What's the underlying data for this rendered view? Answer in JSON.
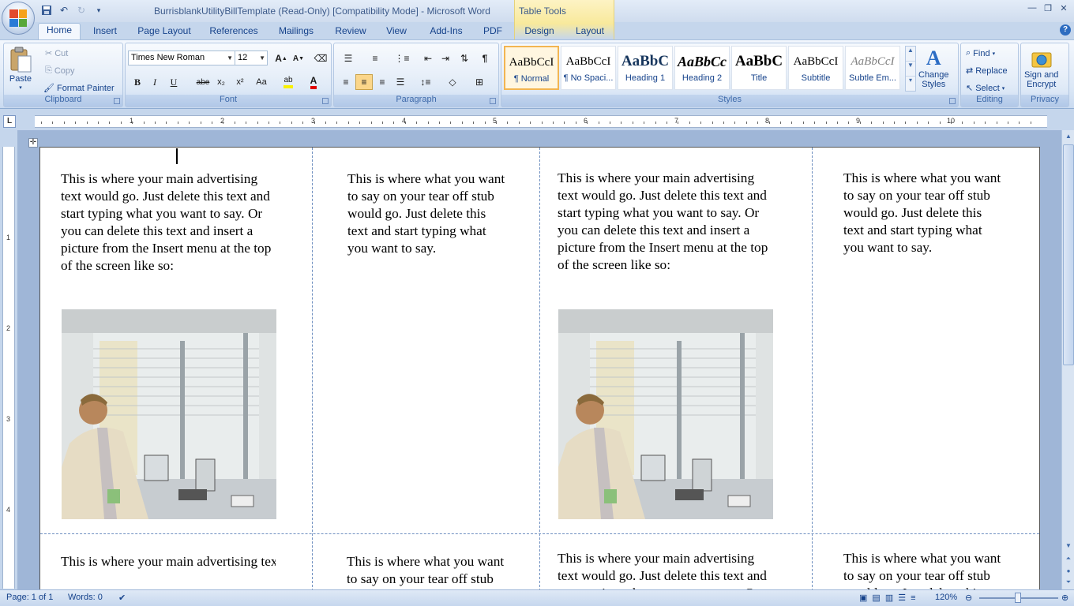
{
  "window": {
    "title": "BurrisblankUtilityBillTemplate (Read-Only) [Compatibility Mode] - Microsoft Word",
    "context_tab_group": "Table Tools"
  },
  "tabs": [
    "Home",
    "Insert",
    "Page Layout",
    "References",
    "Mailings",
    "Review",
    "View",
    "Add-Ins",
    "PDF",
    "Design",
    "Layout"
  ],
  "active_tab": "Home",
  "clipboard": {
    "paste": "Paste",
    "cut": "Cut",
    "copy": "Copy",
    "format_painter": "Format Painter",
    "label": "Clipboard"
  },
  "font": {
    "name": "Times New Roman",
    "size": "12",
    "label": "Font",
    "grow": "A",
    "shrink": "A",
    "bold": "B",
    "italic": "I",
    "underline": "U",
    "strike": "abe",
    "subscript": "x₂",
    "superscript": "x²",
    "change_case": "Aa"
  },
  "paragraph": {
    "label": "Paragraph",
    "pilcrow": "¶"
  },
  "styles": {
    "label": "Styles",
    "items": [
      {
        "sample": "AaBbCcI",
        "name": "¶ Normal",
        "selected": true
      },
      {
        "sample": "AaBbCcI",
        "name": "¶ No Spaci..."
      },
      {
        "sample": "AaBbC",
        "name": "Heading 1"
      },
      {
        "sample": "AaBbCc",
        "name": "Heading 2"
      },
      {
        "sample": "AaBbC",
        "name": "Title"
      },
      {
        "sample": "AaBbCcI",
        "name": "Subtitle"
      },
      {
        "sample": "AaBbCcI",
        "name": "Subtle Em..."
      }
    ],
    "change_styles_line1": "Change",
    "change_styles_line2": "Styles"
  },
  "editing": {
    "label": "Editing",
    "find": "Find",
    "replace": "Replace",
    "select": "Select"
  },
  "privacy": {
    "label": "Privacy",
    "sign_line1": "Sign and",
    "sign_line2": "Encrypt"
  },
  "ruler": {
    "corner": "L",
    "numbers": [
      "1",
      "2",
      "3",
      "4",
      "5",
      "6",
      "7",
      "8",
      "9",
      "10"
    ],
    "vertical_numbers": [
      "1",
      "2",
      "3",
      "4"
    ]
  },
  "document": {
    "main_text": "This is where your main advertising text would go. Just delete this text and start typing what you want to say. Or you can delete this text and insert a picture from the Insert menu at the top of the screen like so:",
    "stub_text": "This is where what you want to say on your tear off stub would go. Just delete this text and start typing what you want to say.",
    "main_text_cut": "This is where your main advertising text would go.  Just",
    "stub_text_cut": "This is where what you want to say on your tear"
  },
  "status": {
    "page": "Page: 1 of 1",
    "words": "Words: 0",
    "zoom": "120%"
  }
}
